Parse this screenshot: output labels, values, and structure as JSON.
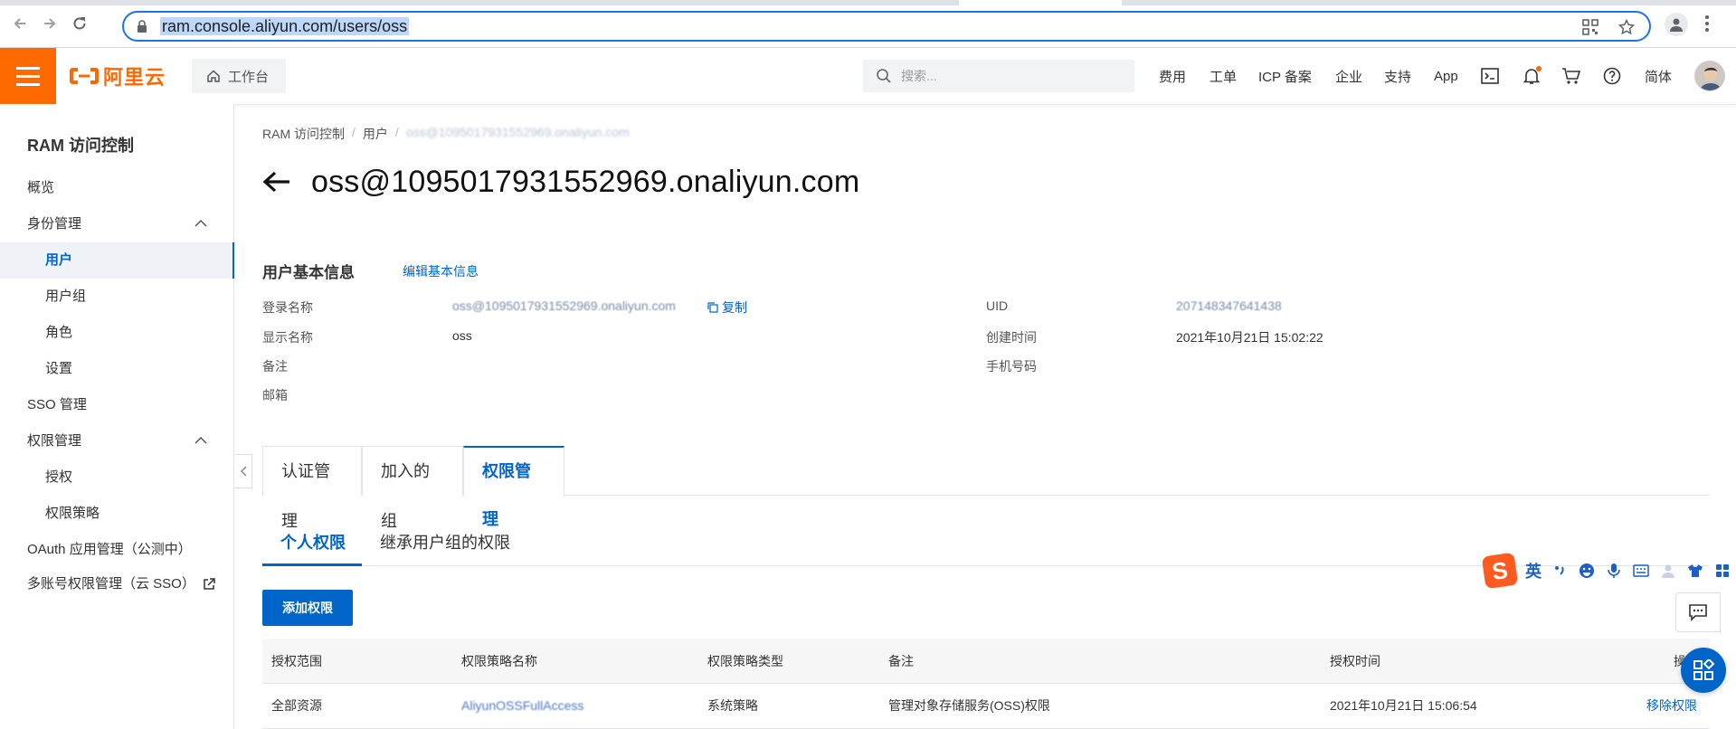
{
  "browser": {
    "url": "ram.console.aliyun.com/users/oss"
  },
  "header": {
    "logo_text": "阿里云",
    "workbench_label": "工作台",
    "search_placeholder": "搜索...",
    "nav": [
      "费用",
      "工单",
      "ICP 备案",
      "企业",
      "支持",
      "App"
    ],
    "language": "简体"
  },
  "sidebar": {
    "title": "RAM 访问控制",
    "items": [
      {
        "label": "概览"
      },
      {
        "label": "身份管理"
      },
      {
        "label": "用户"
      },
      {
        "label": "用户组"
      },
      {
        "label": "角色"
      },
      {
        "label": "设置"
      },
      {
        "label": "SSO 管理"
      },
      {
        "label": "权限管理"
      },
      {
        "label": "授权"
      },
      {
        "label": "权限策略"
      },
      {
        "label": "OAuth 应用管理（公测中）"
      },
      {
        "label": "多账号权限管理（云 SSO）"
      }
    ]
  },
  "main": {
    "breadcrumb": [
      "RAM 访问控制",
      "用户",
      "oss@1095017931552969.onaliyun.com"
    ],
    "title": "oss@1095017931552969.onaliyun.com",
    "basic_info": {
      "title": "用户基本信息",
      "edit_link": "编辑基本信息",
      "copy_label": "复制",
      "fields": [
        {
          "label": "登录名称",
          "value": "oss@1095017931552969.onaliyun.com"
        },
        {
          "label": "显示名称",
          "value": "oss"
        },
        {
          "label": "备注",
          "value": ""
        },
        {
          "label": "邮箱",
          "value": ""
        },
        {
          "label": "UID",
          "value": "207148347641438"
        },
        {
          "label": "创建时间",
          "value": "2021年10月21日 15:02:22"
        },
        {
          "label": "手机号码",
          "value": ""
        }
      ]
    },
    "tabs": [
      "认证管理",
      "加入的组",
      "权限管理"
    ],
    "active_tab": "权限管理",
    "subtabs": [
      "个人权限",
      "继承用户组的权限"
    ],
    "active_subtab": "个人权限",
    "add_button": "添加权限",
    "table": {
      "columns": [
        "授权范围",
        "权限策略名称",
        "权限策略类型",
        "备注",
        "授权时间",
        "操作"
      ],
      "rows": [
        [
          "全部资源",
          "AliyunOSSFullAccess",
          "系统策略",
          "管理对象存储服务(OSS)权限",
          "2021年10月21日 15:06:54",
          "移除权限"
        ]
      ]
    }
  },
  "ime": {
    "logo": "S",
    "mode": "英"
  },
  "colors": {
    "brand_orange": "#ff6a00",
    "primary_blue": "#0064c8",
    "omnibox_focus": "#1a73e8"
  }
}
